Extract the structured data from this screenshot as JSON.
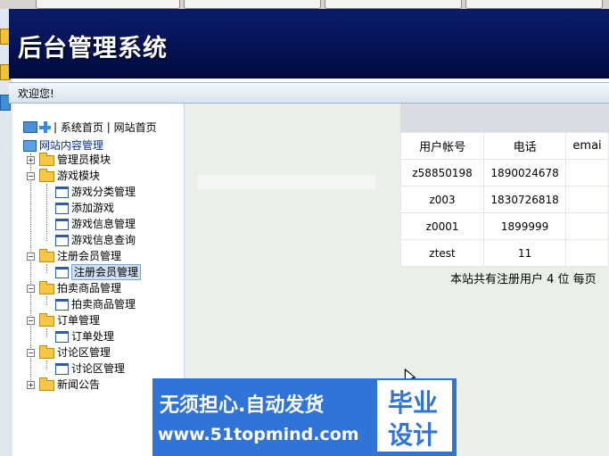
{
  "browser": {
    "tabs": [
      "",
      "",
      "",
      ""
    ]
  },
  "header": {
    "title": "后台管理系统"
  },
  "welcome": {
    "text": "欢迎您!"
  },
  "sidebar": {
    "top_links": [
      "系统首页",
      "网站首页"
    ],
    "separator": "|",
    "root": "网站内容管理",
    "groups": [
      {
        "label": "管理员模块",
        "expanded": false,
        "children": []
      },
      {
        "label": "游戏模块",
        "expanded": true,
        "children": [
          "游戏分类管理",
          "添加游戏",
          "游戏信息管理",
          "游戏信息查询"
        ]
      },
      {
        "label": "注册会员管理",
        "expanded": true,
        "children": [
          "注册会员管理"
        ]
      },
      {
        "label": "拍卖商品管理",
        "expanded": true,
        "children": [
          "拍卖商品管理"
        ]
      },
      {
        "label": "订单管理",
        "expanded": true,
        "children": [
          "订单处理"
        ]
      },
      {
        "label": "讨论区管理",
        "expanded": true,
        "children": [
          "讨论区管理"
        ]
      },
      {
        "label": "新闻公告",
        "expanded": false,
        "children": []
      }
    ],
    "selected": "注册会员管理"
  },
  "table": {
    "headers": [
      "用户帐号",
      "电话",
      "emai"
    ],
    "rows": [
      [
        "z58850198",
        "1890024678",
        ""
      ],
      [
        "z003",
        "1830726818",
        ""
      ],
      [
        "z0001",
        "1899999",
        ""
      ],
      [
        "ztest",
        "11",
        ""
      ]
    ]
  },
  "footer": {
    "text": "本站共有注册用户 4 位 每页"
  },
  "watermark": {
    "line1": "无须担心.自动发货",
    "url": "www.51topmind.com",
    "r1": "毕业",
    "r2": "设计"
  }
}
